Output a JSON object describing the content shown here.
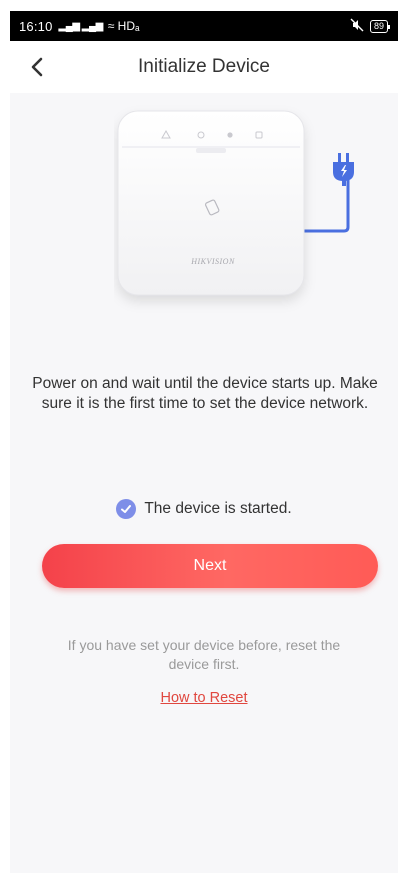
{
  "status_bar": {
    "time": "16:10",
    "signal": "▂▄▆ ▂▄▆",
    "wifi": "≈ HDₐ",
    "battery": "89"
  },
  "header": {
    "title": "Initialize Device"
  },
  "device": {
    "brand": "HIKVISION"
  },
  "main": {
    "description": "Power on and wait until the device starts up. Make sure it is the first time to set the device network.",
    "checkbox_label": "The device is started.",
    "checkbox_checked": true,
    "next_label": "Next",
    "hint": "If you have set your device before, reset the device first.",
    "reset_link": "How to Reset"
  },
  "colors": {
    "accent_red": "#f4424a",
    "check_blue": "#7e8ee8",
    "plug_blue": "#4a6fe0"
  }
}
